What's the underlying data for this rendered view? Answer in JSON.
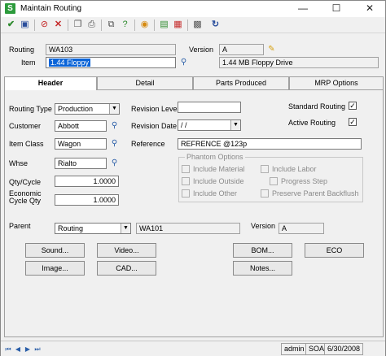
{
  "window": {
    "title": "Maintain Routing",
    "minimize": "—",
    "maximize": "☐",
    "close": "✕"
  },
  "toolbar": {
    "icons": [
      "accept-icon",
      "save-icon",
      "delete-icon",
      "cancel-icon",
      "copy-icon",
      "print-icon",
      "attachment-icon",
      "help-icon",
      "browser-icon",
      "memo-icon",
      "print-preview-icon",
      "calculator-icon",
      "refresh-icon"
    ]
  },
  "header": {
    "routing_label": "Routing",
    "routing_value": "WA103",
    "version_label": "Version",
    "version_value": "A",
    "item_label": "Item",
    "item_value": "1.44 Floppy",
    "item_desc": "1.44 MB Floppy Drive"
  },
  "tabs": [
    "Header",
    "Detail",
    "Parts Produced",
    "MRP Options"
  ],
  "form": {
    "routing_type_label": "Routing Type",
    "routing_type_value": "Production",
    "customer_label": "Customer",
    "customer_value": "Abbott",
    "item_class_label": "Item Class",
    "item_class_value": "Wagon",
    "whse_label": "Whse",
    "whse_value": "Rialto",
    "qty_cycle_label": "Qty/Cycle",
    "qty_cycle_value": "1.0000",
    "econ_label_1": "Economic",
    "econ_label_2": "Cycle Qty",
    "econ_value": "1.0000",
    "revision_level_label": "Revision Level",
    "revision_level_value": "",
    "revision_date_label": "Revision Date",
    "revision_date_value": " / /",
    "reference_label": "Reference",
    "reference_value": "REFRENCE @123p",
    "standard_routing_label": "Standard Routing",
    "standard_routing_checked": "✓",
    "active_routing_label": "Active Routing",
    "active_routing_checked": "✓",
    "phantom_title": "Phantom Options",
    "phantom": {
      "include_material": "Include Material",
      "include_labor": "Include Labor",
      "include_outside": "Include Outside",
      "progress_step": "Progress Step",
      "include_other": "Include Other",
      "preserve_parent": "Preserve Parent Backflush"
    },
    "parent_label": "Parent",
    "parent_type": "Routing",
    "parent_value": "WA101",
    "parent_version_label": "Version",
    "parent_version_value": "A"
  },
  "buttons": {
    "sound": "Sound...",
    "video": "Video...",
    "image": "Image...",
    "cad": "CAD...",
    "bom": "BOM...",
    "eco": "ECO",
    "notes": "Notes..."
  },
  "status": {
    "user": "admin",
    "company": "SOA",
    "date": "6/30/2008"
  }
}
